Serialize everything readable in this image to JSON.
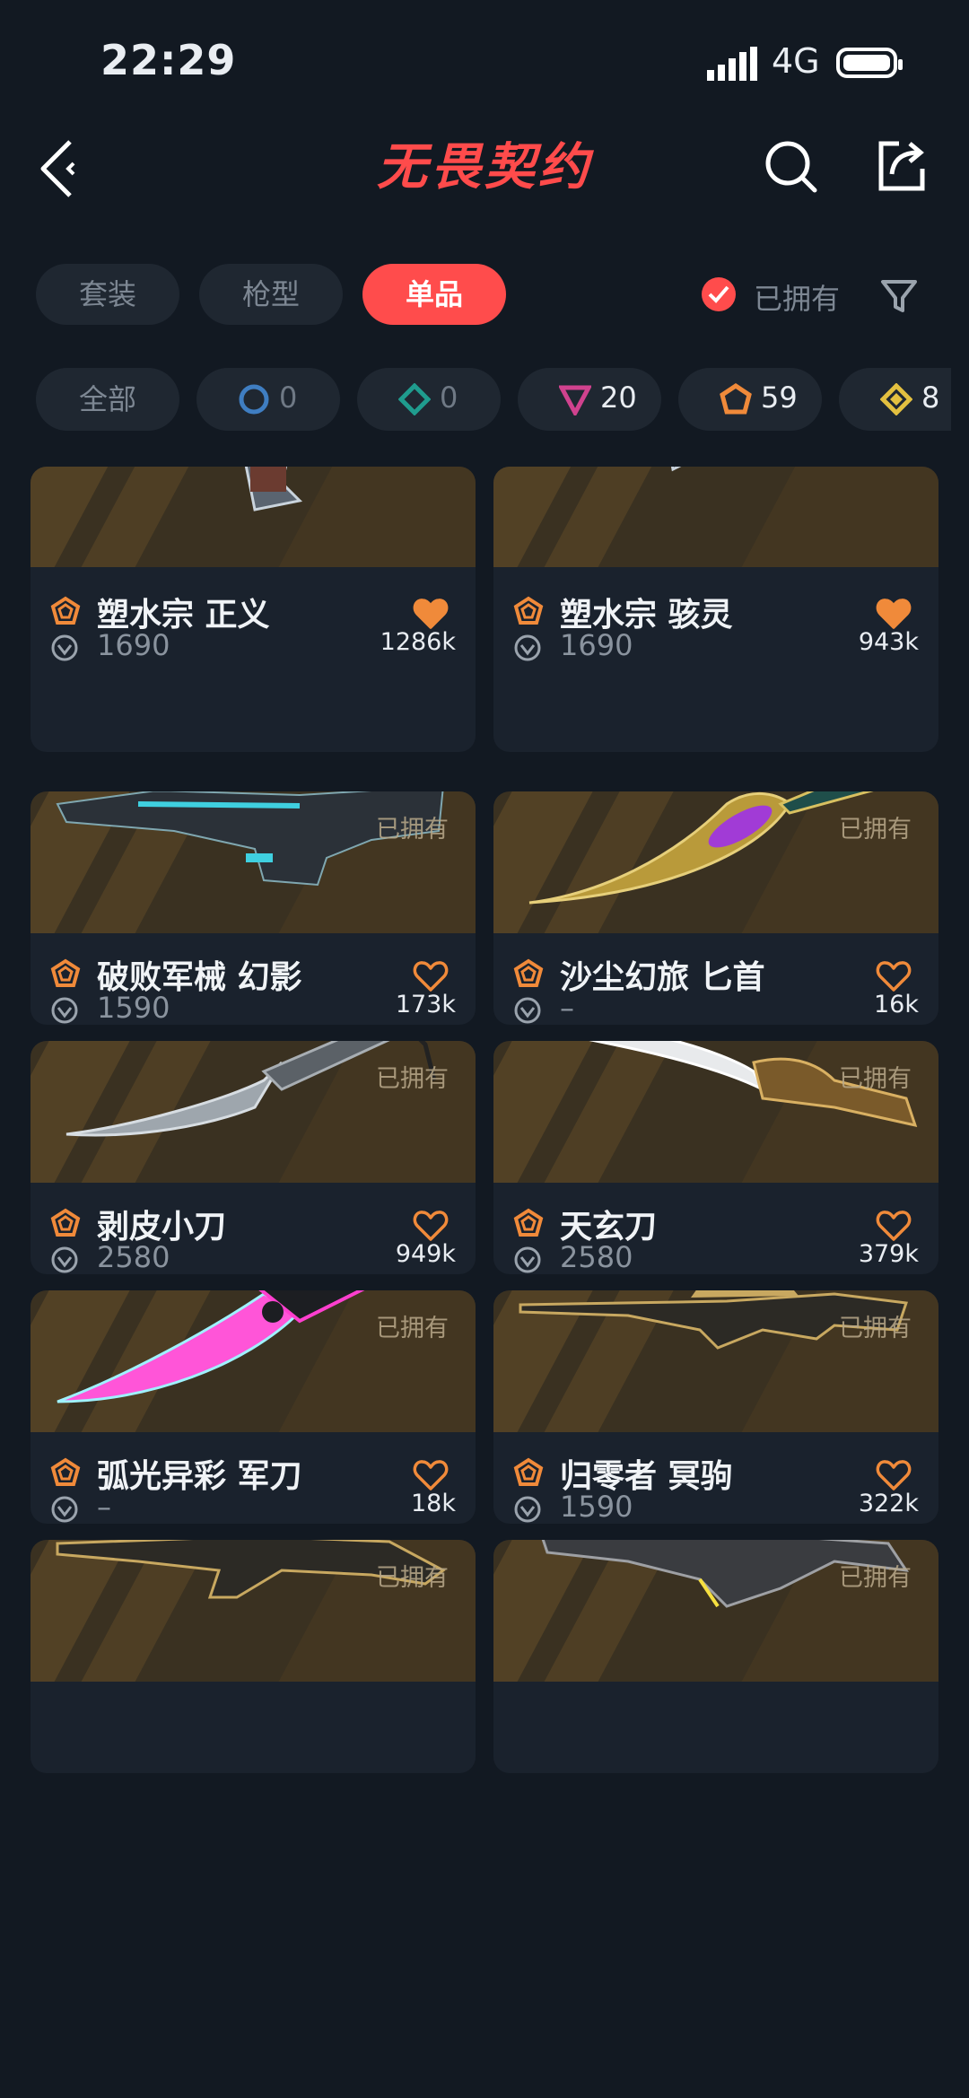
{
  "status": {
    "time": "22:29",
    "network": "4G"
  },
  "header": {
    "logo": "无畏契约"
  },
  "tabs": [
    {
      "label": "套装",
      "active": false
    },
    {
      "label": "枪型",
      "active": false
    },
    {
      "label": "单品",
      "active": true
    }
  ],
  "owned_filter": {
    "label": "已拥有",
    "checked": true
  },
  "rarity_chips": [
    {
      "label": "全部"
    },
    {
      "icon": "select-tier-icon",
      "count": "0",
      "color": "#3f7ec2"
    },
    {
      "icon": "deluxe-tier-icon",
      "count": "0",
      "color": "#1f9c8e"
    },
    {
      "icon": "premium-tier-icon",
      "count": "20",
      "color": "#d0428e"
    },
    {
      "icon": "ultra-tier-icon",
      "count": "59",
      "color": "#f08a3a"
    },
    {
      "icon": "exclusive-tier-icon",
      "count": "8",
      "color": "#e3c040"
    }
  ],
  "items": [
    {
      "name": "塑水宗 正义",
      "price": "1690",
      "likes": "1286k",
      "liked": true,
      "owned": "",
      "weapon": "pistol-blue"
    },
    {
      "name": "塑水宗 骇灵",
      "price": "1690",
      "likes": "943k",
      "liked": true,
      "owned": "",
      "weapon": "smg-blue"
    },
    {
      "name": "破败军械 幻影",
      "price": "1590",
      "likes": "173k",
      "liked": false,
      "owned": "已拥有",
      "weapon": "rifle-dark"
    },
    {
      "name": "沙尘幻旅 匕首",
      "price": "–",
      "likes": "16k",
      "liked": false,
      "owned": "已拥有",
      "weapon": "dagger-gold"
    },
    {
      "name": "剥皮小刀",
      "price": "2580",
      "likes": "949k",
      "liked": false,
      "owned": "已拥有",
      "weapon": "knife-grey"
    },
    {
      "name": "天玄刀",
      "price": "2580",
      "likes": "379k",
      "liked": false,
      "owned": "已拥有",
      "weapon": "sabre-silver"
    },
    {
      "name": "弧光异彩 军刀",
      "price": "–",
      "likes": "18k",
      "liked": false,
      "owned": "已拥有",
      "weapon": "knife-pink"
    },
    {
      "name": "归零者 冥驹",
      "price": "1590",
      "likes": "322k",
      "liked": false,
      "owned": "已拥有",
      "weapon": "sniper-gold"
    },
    {
      "name": "",
      "price": "",
      "likes": "",
      "liked": false,
      "owned": "已拥有",
      "weapon": "rifle-gold"
    },
    {
      "name": "",
      "price": "",
      "likes": "",
      "liked": false,
      "owned": "已拥有",
      "weapon": "dragon-rifle"
    }
  ],
  "colors": {
    "accent": "#ff4c4c",
    "tier": "#f08a3a",
    "heart": "#f08a3a"
  }
}
